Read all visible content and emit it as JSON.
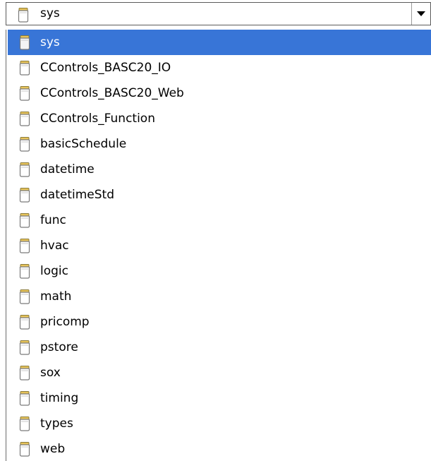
{
  "combo": {
    "selected_value": "sys",
    "icon": "kit-jar-icon",
    "dropdown_icon": "triangle-down-icon"
  },
  "list": {
    "selected_index": 0,
    "items": [
      {
        "label": "sys",
        "icon": "kit-jar-icon"
      },
      {
        "label": "CControls_BASC20_IO",
        "icon": "kit-jar-icon"
      },
      {
        "label": "CControls_BASC20_Web",
        "icon": "kit-jar-icon"
      },
      {
        "label": "CControls_Function",
        "icon": "kit-jar-icon"
      },
      {
        "label": "basicSchedule",
        "icon": "kit-jar-icon"
      },
      {
        "label": "datetime",
        "icon": "kit-jar-icon"
      },
      {
        "label": "datetimeStd",
        "icon": "kit-jar-icon"
      },
      {
        "label": "func",
        "icon": "kit-jar-icon"
      },
      {
        "label": "hvac",
        "icon": "kit-jar-icon"
      },
      {
        "label": "logic",
        "icon": "kit-jar-icon"
      },
      {
        "label": "math",
        "icon": "kit-jar-icon"
      },
      {
        "label": "pricomp",
        "icon": "kit-jar-icon"
      },
      {
        "label": "pstore",
        "icon": "kit-jar-icon"
      },
      {
        "label": "sox",
        "icon": "kit-jar-icon"
      },
      {
        "label": "timing",
        "icon": "kit-jar-icon"
      },
      {
        "label": "types",
        "icon": "kit-jar-icon"
      },
      {
        "label": "web",
        "icon": "kit-jar-icon"
      }
    ]
  },
  "colors": {
    "selection": "#3875d7",
    "selection_text": "#ffffff",
    "jar_outline": "#7a7a7a",
    "jar_lid": "#e8c45a",
    "jar_body": "#ffffff"
  }
}
